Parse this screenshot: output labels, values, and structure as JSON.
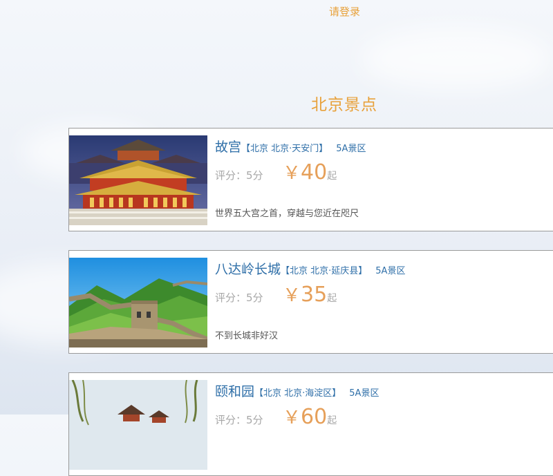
{
  "header": {
    "login_label": "请登录"
  },
  "section": {
    "title": "北京景点"
  },
  "colors": {
    "accent": "#e8a13a",
    "link": "#2f6fa8",
    "price": "#e6a05a"
  },
  "attractions": [
    {
      "name": "故宫",
      "location": "【北京 北京·天安门】",
      "grade": "5A景区",
      "score": "评分：5分",
      "currency": "￥",
      "price": "40",
      "price_unit": "起",
      "description": "世界五大宫之首，穿越与您近在咫尺",
      "image": "forbidden-city-palace"
    },
    {
      "name": "八达岭长城",
      "location": "【北京 北京·延庆县】",
      "grade": "5A景区",
      "score": "评分：5分",
      "currency": "￥",
      "price": "35",
      "price_unit": "起",
      "description": "不到长城非好汉",
      "image": "great-wall"
    },
    {
      "name": "颐和园",
      "location": "【北京 北京·海淀区】",
      "grade": "5A景区",
      "score": "评分：5分",
      "currency": "￥",
      "price": "60",
      "price_unit": "起",
      "description": "",
      "image": "summer-palace"
    }
  ]
}
